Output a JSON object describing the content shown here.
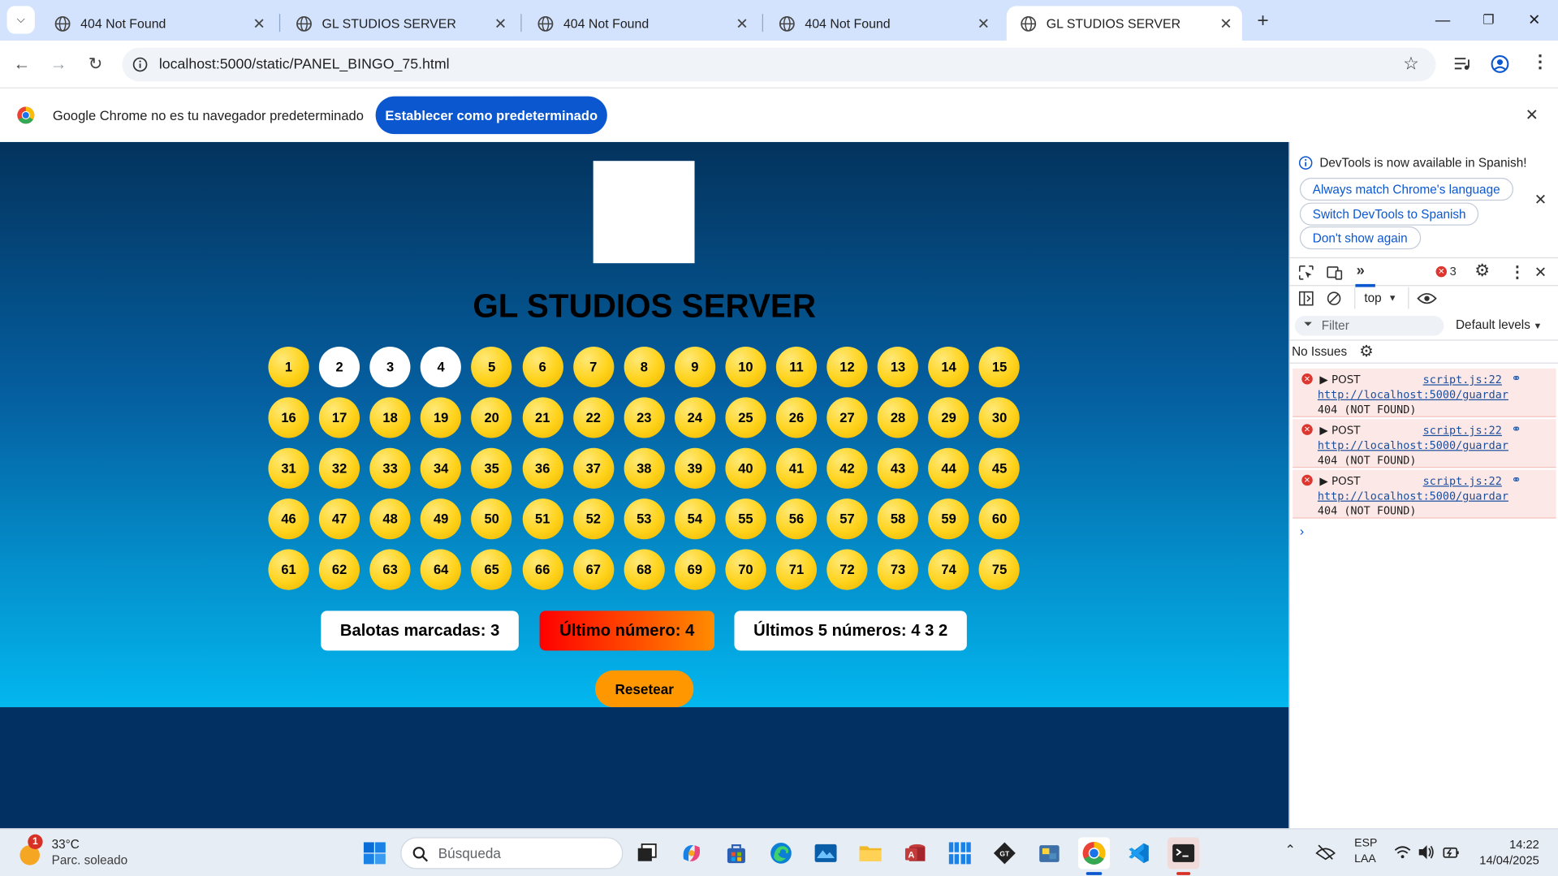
{
  "browser": {
    "tabs": [
      {
        "title": "404 Not Found",
        "active": false
      },
      {
        "title": "GL STUDIOS SERVER",
        "active": false
      },
      {
        "title": "404 Not Found",
        "active": false
      },
      {
        "title": "404 Not Found",
        "active": false
      },
      {
        "title": "GL STUDIOS SERVER",
        "active": true
      }
    ],
    "url": "localhost:5000/static/PANEL_BINGO_75.html",
    "infobar": {
      "message": "Google Chrome no es tu navegador predeterminado",
      "button": "Establecer como predeterminado"
    }
  },
  "page": {
    "title": "GL STUDIOS SERVER",
    "marked_balls": [
      2,
      3,
      4
    ],
    "balls": [
      "1",
      "2",
      "3",
      "4",
      "5",
      "6",
      "7",
      "8",
      "9",
      "10",
      "11",
      "12",
      "13",
      "14",
      "15",
      "16",
      "17",
      "18",
      "19",
      "20",
      "21",
      "22",
      "23",
      "24",
      "25",
      "26",
      "27",
      "28",
      "29",
      "30",
      "31",
      "32",
      "33",
      "34",
      "35",
      "36",
      "37",
      "38",
      "39",
      "40",
      "41",
      "42",
      "43",
      "44",
      "45",
      "46",
      "47",
      "48",
      "49",
      "50",
      "51",
      "52",
      "53",
      "54",
      "55",
      "56",
      "57",
      "58",
      "59",
      "60",
      "61",
      "62",
      "63",
      "64",
      "65",
      "66",
      "67",
      "68",
      "69",
      "70",
      "71",
      "72",
      "73",
      "74",
      "75"
    ],
    "stats": {
      "marked": "Balotas marcadas: 3",
      "last": "Último número: 4",
      "last5": "Últimos 5 números: 4 3 2"
    },
    "reset_button": "Resetear",
    "colors": {
      "ball": "#ffd21a",
      "marked_ball": "#ffffff",
      "reset": "#ff9800",
      "last_number_from": "#ff0000",
      "last_number_to": "#ff8c00"
    }
  },
  "devtools": {
    "notice": "DevTools is now available in Spanish!",
    "buttons": [
      "Always match Chrome's language",
      "Switch DevTools to Spanish",
      "Don't show again"
    ],
    "error_count": "3",
    "context": "top",
    "filter_placeholder": "Filter",
    "levels": "Default levels",
    "no_issues": "No Issues",
    "errors": [
      {
        "method": "POST",
        "source": "script.js:22",
        "url": "http://localhost:5000/guardar",
        "status": "404 (NOT FOUND)"
      },
      {
        "method": "POST",
        "source": "script.js:22",
        "url": "http://localhost:5000/guardar",
        "status": "404 (NOT FOUND)"
      },
      {
        "method": "POST",
        "source": "script.js:22",
        "url": "http://localhost:5000/guardar",
        "status": "404 (NOT FOUND)"
      }
    ]
  },
  "taskbar": {
    "weather_temp": "33°C",
    "weather_desc": "Parc. soleado",
    "weather_badge": "1",
    "search_placeholder": "Búsqueda",
    "lang_top": "ESP",
    "lang_bottom": "LAA",
    "time": "14:22",
    "date": "14/04/2025"
  }
}
